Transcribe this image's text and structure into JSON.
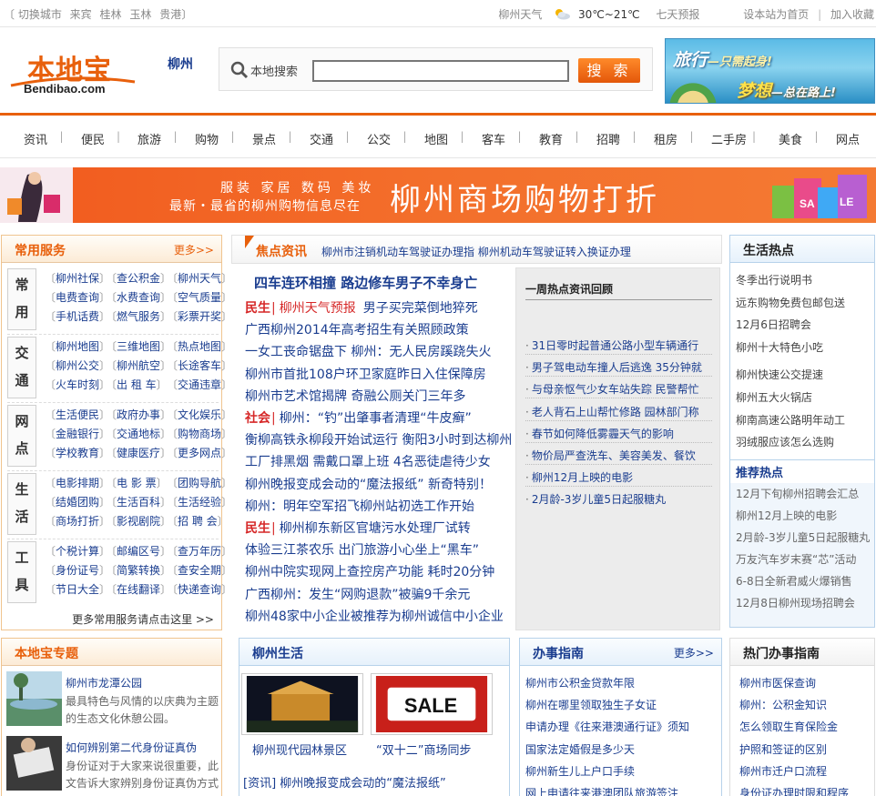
{
  "topbar": {
    "left": [
      "〔 切换城市",
      "来宾",
      "桂林",
      "玉林",
      "贵港〕"
    ],
    "weather_label": "柳州天气",
    "temp": "30℃~21℃",
    "forecast": "七天预报",
    "set_home": "设本站为首页",
    "sep": "|",
    "favorite": "加入收藏"
  },
  "header": {
    "logo_cn": "本地宝",
    "logo_en": "Bendibao.com",
    "city": "柳州",
    "search_label": "本地搜索",
    "search_value": "",
    "search_button": "搜 索",
    "ad_line1": "旅行",
    "ad_line1b": "—只需起身!",
    "ad_line2": "梦想",
    "ad_line2b": "—总在路上!"
  },
  "nav": [
    "资讯",
    "便民",
    "旅游",
    "购物",
    "景点",
    "交通",
    "公交",
    "地图",
    "客车",
    "教育",
    "招聘",
    "租房",
    "二手房",
    "美食",
    "网点"
  ],
  "banner": {
    "line1": "服装  家居  数码  美妆",
    "line2": "最新・最省的柳州购物信息尽在",
    "big": "柳州商场购物打折"
  },
  "services": {
    "title": "常用服务",
    "more": "更多>>",
    "groups": [
      {
        "name": [
          "常",
          "用"
        ],
        "links": [
          "柳州社保",
          "查公积金",
          "柳州天气",
          "电费查询",
          "水费查询",
          "空气质量",
          "手机话费",
          "燃气服务",
          "彩票开奖"
        ]
      },
      {
        "name": [
          "交",
          "通"
        ],
        "links": [
          "柳州地图",
          "三维地图",
          "热点地图",
          "柳州公交",
          "柳州航空",
          "长途客车",
          "火车时刻",
          "出 租 车",
          "交通违章"
        ]
      },
      {
        "name": [
          "网",
          "点"
        ],
        "links": [
          "生活便民",
          "政府办事",
          "文化娱乐",
          "金融银行",
          "交通地标",
          "购物商场",
          "学校教育",
          "健康医疗",
          "更多网点"
        ]
      },
      {
        "name": [
          "生",
          "活"
        ],
        "links": [
          "电影排期",
          "电 影 票",
          "团购导航",
          "结婚团购",
          "生活百科",
          "生活经验",
          "商场打折",
          "影视剧院",
          "招 聘 会"
        ]
      },
      {
        "name": [
          "工",
          "具"
        ],
        "links": [
          "个税计算",
          "邮编区号",
          "查万年历",
          "身份证号",
          "简繁转换",
          "查安全期",
          "节日大全",
          "在线翻译",
          "快递查询"
        ]
      }
    ],
    "footer": "更多常用服务请点击这里 >>"
  },
  "focus": {
    "title": "焦点资讯",
    "sub": "柳州市注销机动车驾驶证办理指 柳州机动车驾驶证转入换证办理",
    "headline": "四车连环相撞  路边修车男子不幸身亡",
    "news": [
      {
        "tag": "民生",
        "tag2": "柳州天气预报",
        "text": "男子买完菜倒地猝死"
      },
      {
        "text": "广西柳州2014年高考招生有关照顾政策"
      },
      {
        "text": "一女工丧命锯盘下  柳州：无人民房蹊跷失火"
      },
      {
        "text": "柳州市首批108户环卫家庭昨日入住保障房"
      },
      {
        "text": "柳州市艺术馆揭牌  奇融公厕关门三年多"
      },
      {
        "tag": "社会",
        "text": "柳州：“钓”出肇事者清理“牛皮癣”"
      },
      {
        "text": "衡柳高铁永柳段开始试运行  衡阳3小时到达柳州"
      },
      {
        "text": "工厂排黑烟  需戴口罩上班  4名恶徒虐待少女"
      },
      {
        "text": "柳州晚报变成会动的“魔法报纸”  新奇特别！"
      },
      {
        "text": "柳州：明年空军招飞柳州站初选工作开始"
      },
      {
        "tag": "民生",
        "text": "柳州柳东新区官塘污水处理厂试转"
      },
      {
        "text": "体验三江茶农乐  出门旅游小心坐上“黑车”"
      },
      {
        "text": "柳州中院实现网上查控房产功能  耗时20分钟"
      },
      {
        "text": "广西柳州：发生“网购退款”被骗9千余元"
      },
      {
        "text": "柳州48家中小企业被推荐为柳州诚信中小企业"
      }
    ],
    "hot_title": "一周热点资讯回顾",
    "hot": [
      "31日零时起普通公路小型车辆通行",
      "男子驾电动车撞人后逃逸  35分钟就",
      "与母亲怄气少女车站失踪  民警帮忙",
      "老人背石上山帮忙修路  园林部门称",
      "春节如何降低雾霾天气的影响",
      "物价局严查洗车、美容美发、餐饮",
      "柳州12月上映的电影",
      "2月龄-3岁儿童5日起服糖丸"
    ]
  },
  "lifehot": {
    "title": "生活热点",
    "items": [
      "冬季出行说明书",
      "远东购物免费包邮包送",
      "12月6日招聘会",
      "柳州十大特色小吃",
      "柳州快速公交提速",
      "柳州五大火锅店",
      "柳南高速公路明年动工",
      "羽绒服应该怎么选购"
    ],
    "sub": "推荐热点",
    "items2": [
      "12月下旬柳州招聘会汇总",
      "柳州12月上映的电影",
      "2月龄-3岁儿童5日起服糖丸",
      "万友汽车岁末赛“芯”活动",
      "6-8日全新君威火爆销售",
      "12月8日柳州现场招聘会"
    ]
  },
  "topic": {
    "title": "本地宝专题",
    "items": [
      {
        "title": "柳州市龙潭公园",
        "desc": "最具特色与风情的以庆典为主题的生态文化休憩公园。"
      },
      {
        "title": "如何辨别第二代身份证真伪",
        "desc": "身份证对于大家来说很重要，此文告诉大家辨别身份证真伪方式"
      }
    ]
  },
  "life": {
    "title": "柳州生活",
    "pics": [
      {
        "cap": "柳州现代园林景区"
      },
      {
        "cap": "“双十二”商场同步"
      }
    ],
    "sale_text": "SALE",
    "news": "[资讯] 柳州晚报变成会动的“魔法报纸”"
  },
  "guide": {
    "title": "办事指南",
    "more": "更多>>",
    "items": [
      "柳州市公积金贷款年限",
      "柳州在哪里领取独生子女证",
      "申请办理《往来港澳通行证》须知",
      "国家法定婚假是多少天",
      "柳州新生儿上户口手续",
      "网上申请往来港澳团队旅游签注"
    ]
  },
  "hotguide": {
    "title": "热门办事指南",
    "items": [
      "柳州市医保查询",
      "柳州：公积金知识",
      "怎么领取生育保险金",
      "护照和签证的区别",
      "柳州市迁户口流程",
      "身份证办理时限和程序"
    ]
  }
}
